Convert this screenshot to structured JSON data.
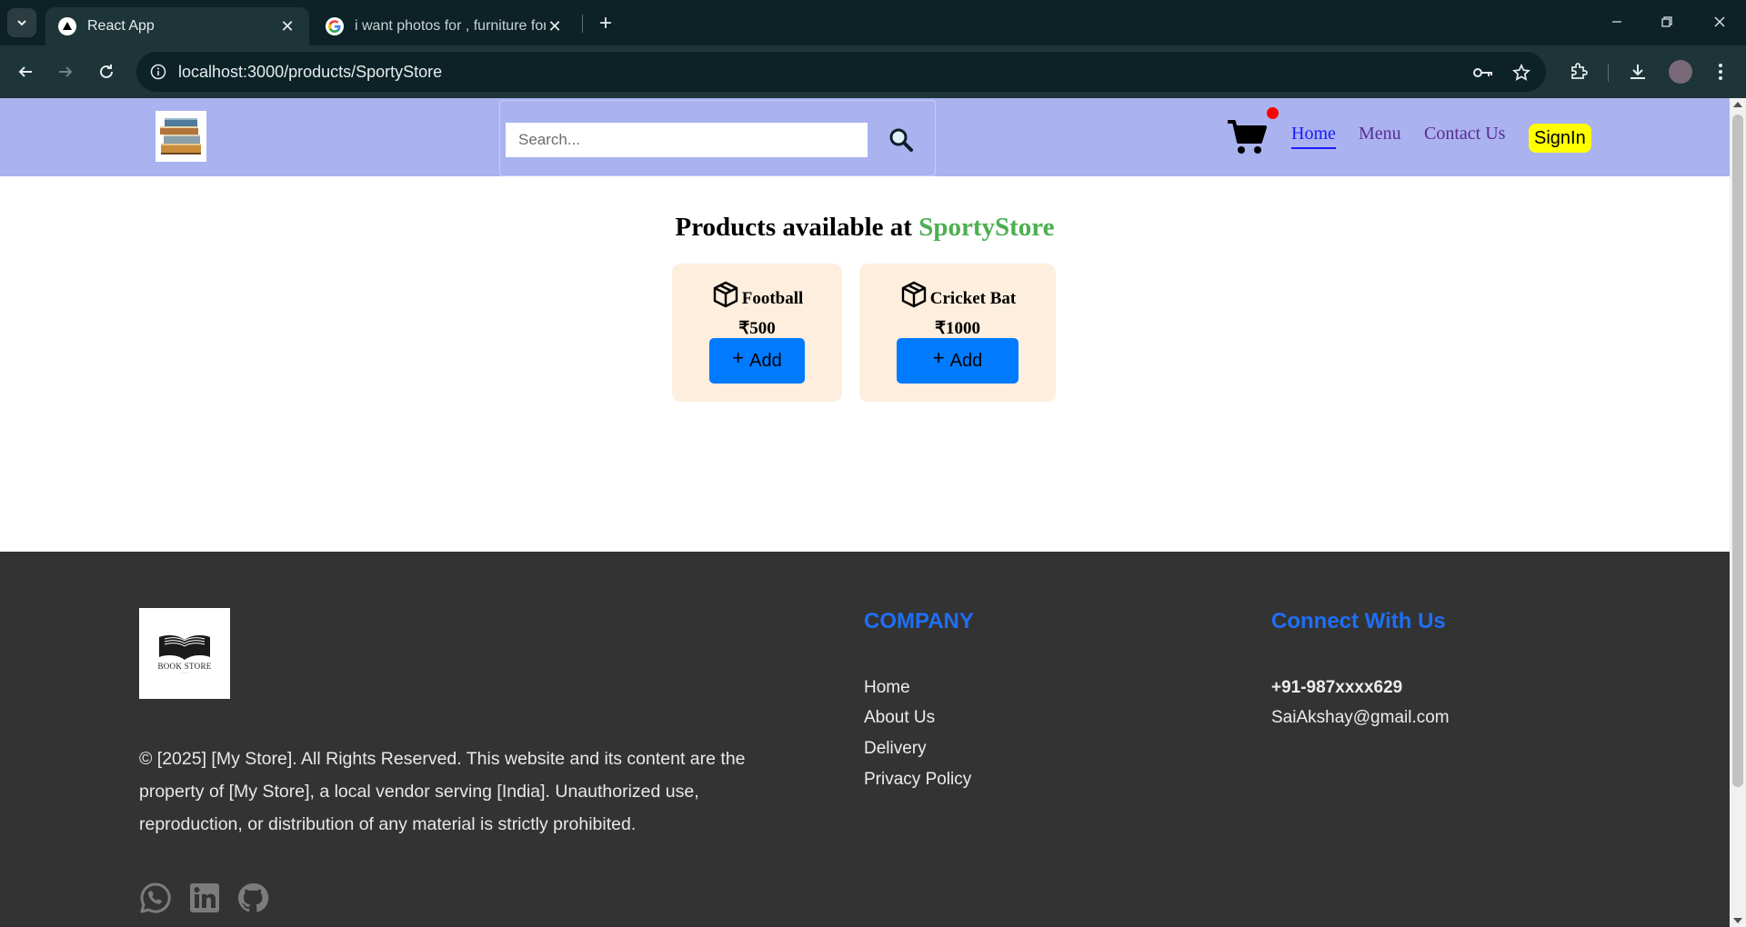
{
  "browser": {
    "tabs": [
      {
        "title": "React App",
        "active": true
      },
      {
        "title": "i want photos for , furniture for",
        "active": false
      }
    ],
    "url": "localhost:3000/products/SportyStore"
  },
  "header": {
    "search_placeholder": "Search...",
    "nav": {
      "home": "Home",
      "menu": "Menu",
      "contact": "Contact Us"
    },
    "signin": "SignIn",
    "cart_badge_color": "#ff0000"
  },
  "main": {
    "heading_prefix": "Products available at",
    "store_name": "SportyStore",
    "products": [
      {
        "name": "Football",
        "price": "₹500",
        "add_label": "Add"
      },
      {
        "name": "Cricket Bat",
        "price": "₹1000",
        "add_label": "Add"
      }
    ]
  },
  "footer": {
    "logo_text": "BOOK STORE",
    "copyright": "© [2025] [My Store]. All Rights Reserved. This website and its content are the property of [My Store], a local vendor serving [India]. Unauthorized use, reproduction, or distribution of any material is strictly prohibited.",
    "company_title": "COMPANY",
    "company_links": [
      "Home",
      "About Us",
      "Delivery",
      "Privacy Policy"
    ],
    "connect_title": "Connect With Us",
    "phone": "+91-987xxxx629",
    "email": "SaiAkshay@gmail.com",
    "social_icons": [
      "whatsapp-icon",
      "linkedin-icon",
      "github-icon"
    ]
  },
  "colors": {
    "header_bg": "#aab2f0",
    "accent_store": "#4caf50",
    "add_button": "#007bff",
    "card_bg": "#fdeedd",
    "footer_bg": "#333333",
    "footer_heading": "#1e6ff5",
    "signin_bg": "#ffff00"
  }
}
